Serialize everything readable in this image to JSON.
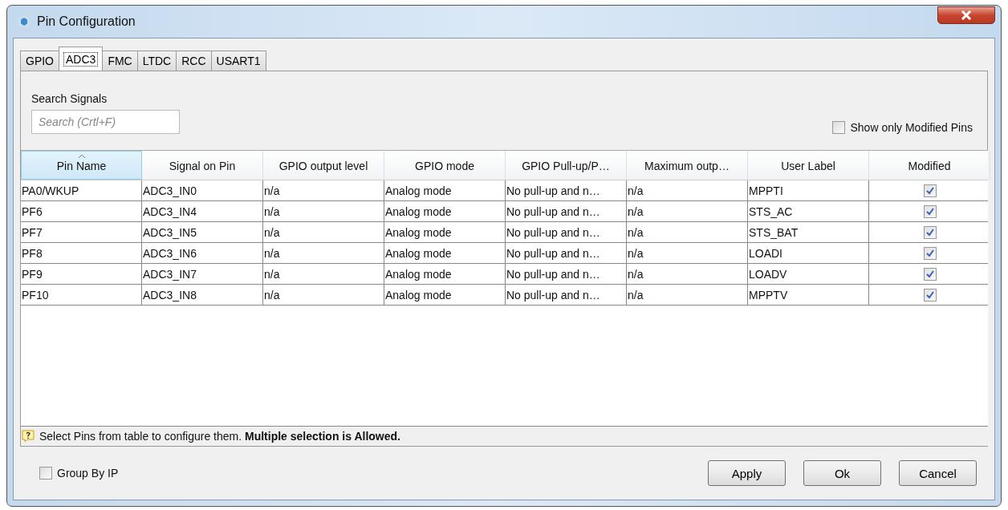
{
  "window": {
    "title": "Pin Configuration"
  },
  "tabs": [
    {
      "label": "GPIO",
      "selected": false
    },
    {
      "label": "ADC3",
      "selected": true
    },
    {
      "label": "FMC",
      "selected": false
    },
    {
      "label": "LTDC",
      "selected": false
    },
    {
      "label": "RCC",
      "selected": false
    },
    {
      "label": "USART1",
      "selected": false
    }
  ],
  "search": {
    "label": "Search Signals",
    "placeholder": "Search (Crtl+F)"
  },
  "show_only_modified": {
    "label": "Show only Modified Pins",
    "checked": false
  },
  "table": {
    "columns": [
      {
        "label": "Pin Name",
        "sorted": true
      },
      {
        "label": "Signal on Pin",
        "sorted": false
      },
      {
        "label": "GPIO output level",
        "sorted": false
      },
      {
        "label": "GPIO mode",
        "sorted": false
      },
      {
        "label": "GPIO Pull-up/P…",
        "sorted": false
      },
      {
        "label": "Maximum outp…",
        "sorted": false
      },
      {
        "label": "User Label",
        "sorted": false
      },
      {
        "label": "Modified",
        "sorted": false
      }
    ],
    "rows": [
      {
        "cells": [
          "PA0/WKUP",
          "ADC3_IN0",
          "n/a",
          "Analog mode",
          "No pull-up and n…",
          "n/a",
          "MPPTI"
        ],
        "modified": true
      },
      {
        "cells": [
          "PF6",
          "ADC3_IN4",
          "n/a",
          "Analog mode",
          "No pull-up and n…",
          "n/a",
          "STS_AC"
        ],
        "modified": true
      },
      {
        "cells": [
          "PF7",
          "ADC3_IN5",
          "n/a",
          "Analog mode",
          "No pull-up and n…",
          "n/a",
          "STS_BAT"
        ],
        "modified": true
      },
      {
        "cells": [
          "PF8",
          "ADC3_IN6",
          "n/a",
          "Analog mode",
          "No pull-up and n…",
          "n/a",
          "LOADI"
        ],
        "modified": true
      },
      {
        "cells": [
          "PF9",
          "ADC3_IN7",
          "n/a",
          "Analog mode",
          "No pull-up and n…",
          "n/a",
          "LOADV"
        ],
        "modified": true
      },
      {
        "cells": [
          "PF10",
          "ADC3_IN8",
          "n/a",
          "Analog mode",
          "No pull-up and n…",
          "n/a",
          "MPPTV"
        ],
        "modified": true
      }
    ]
  },
  "hint": "Select Pins from table to configure them. **Multiple selection is Allowed.**",
  "group_by_ip": {
    "label": "Group By IP",
    "checked": false
  },
  "buttons": [
    "Apply",
    "Ok",
    "Cancel"
  ]
}
